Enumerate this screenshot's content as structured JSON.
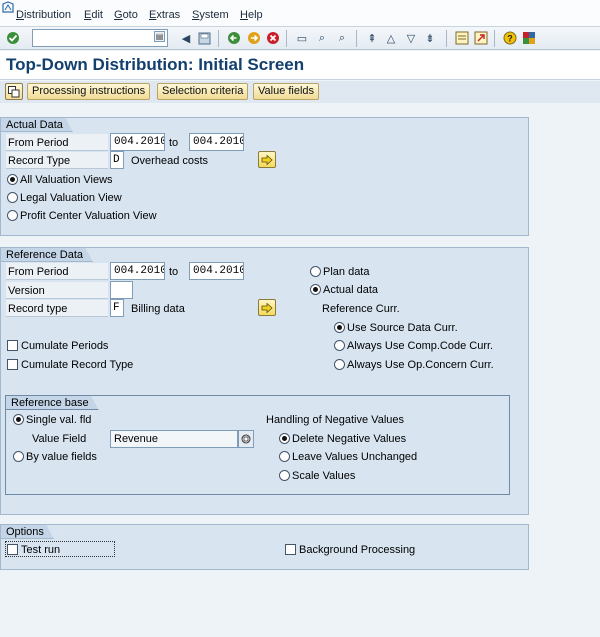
{
  "menu": {
    "items": [
      {
        "label": "Distribution",
        "hotkey": "D",
        "rest": "istribution"
      },
      {
        "label": "Edit",
        "hotkey": "E",
        "rest": "dit"
      },
      {
        "label": "Goto",
        "hotkey": "G",
        "rest": "oto"
      },
      {
        "label": "Extras",
        "hotkey": "E",
        "rest": "xtras"
      },
      {
        "label": "System",
        "hotkey": "S",
        "rest": "ystem"
      },
      {
        "label": "Help",
        "hotkey": "H",
        "rest": "elp"
      }
    ]
  },
  "toolbar": {
    "command_value": "",
    "icons": [
      "enter-icon",
      "back-icon",
      "save-icon",
      "back-nav-icon",
      "exit-icon",
      "cancel-icon",
      "print-icon",
      "find-icon",
      "find-next-icon",
      "first-page-icon",
      "prev-page-icon",
      "next-page-icon",
      "last-page-icon",
      "new-session-icon",
      "shortcut-icon",
      "help-icon",
      "layout-icon"
    ]
  },
  "page": {
    "title": "Top-Down Distribution: Initial Screen"
  },
  "app_toolbar": {
    "processing_instructions": "Processing instructions",
    "selection_criteria": "Selection criteria",
    "value_fields": "Value fields"
  },
  "actual_data": {
    "group_title": "Actual Data",
    "from_period_label": "From Period",
    "from_period_value": "004.2010",
    "to_label": "to",
    "to_period_value": "004.2010",
    "record_type_label": "Record Type",
    "record_type_value": "D",
    "record_type_text": "Overhead costs",
    "valuation_options": [
      {
        "label": "All Valuation Views",
        "selected": true
      },
      {
        "label": "Legal Valuation View",
        "selected": false
      },
      {
        "label": "Profit Center Valuation View",
        "selected": false
      }
    ]
  },
  "reference_data": {
    "group_title": "Reference Data",
    "from_period_label": "From Period",
    "from_period_value": "004.2010",
    "to_label": "to",
    "to_period_value": "004.2010",
    "version_label": "Version",
    "version_value": "",
    "record_type_label": "Record type",
    "record_type_value": "F",
    "record_type_text": "Billing data",
    "plan_data_label": "Plan data",
    "plan_data_selected": false,
    "actual_data_label": "Actual data",
    "actual_data_selected": true,
    "reference_curr_label": "Reference Curr.",
    "currency_options": [
      {
        "label": "Use Source Data Curr.",
        "selected": true
      },
      {
        "label": "Always Use Comp.Code Curr.",
        "selected": false
      },
      {
        "label": "Always Use Op.Concern Curr.",
        "selected": false
      }
    ],
    "cumulate_periods_label": "Cumulate Periods",
    "cumulate_periods_checked": false,
    "cumulate_record_type_label": "Cumulate Record Type",
    "cumulate_record_type_checked": false,
    "reference_base": {
      "group_title": "Reference base",
      "single_val_label": "Single val. fld",
      "single_val_selected": true,
      "value_field_label": "Value Field",
      "value_field_value": "Revenue",
      "by_value_fields_label": "By value fields",
      "by_value_fields_selected": false,
      "negative_heading": "Handling of Negative Values",
      "negative_options": [
        {
          "label": "Delete Negative Values",
          "selected": true
        },
        {
          "label": "Leave Values Unchanged",
          "selected": false
        },
        {
          "label": "Scale Values",
          "selected": false
        }
      ]
    }
  },
  "options": {
    "group_title": "Options",
    "test_run_label": "Test run",
    "test_run_checked": false,
    "background_label": "Background Processing",
    "background_checked": false
  }
}
